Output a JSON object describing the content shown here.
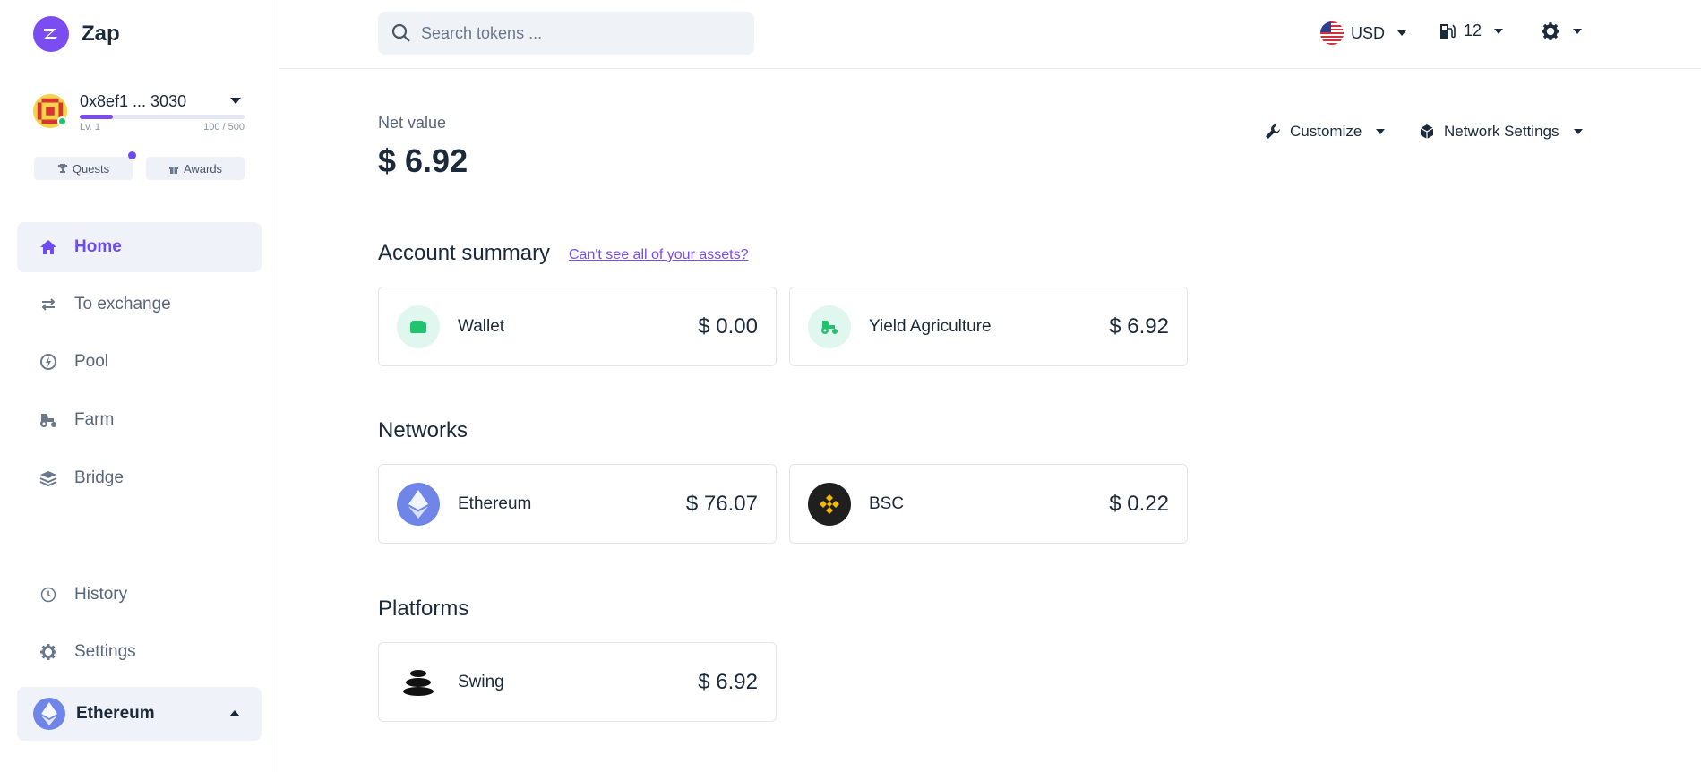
{
  "brand": {
    "name": "Zap"
  },
  "account": {
    "address": "0x8ef1 ... 3030",
    "level": "Lv. 1",
    "xp": "100 / 500",
    "xp_progress": 0.2
  },
  "chips": {
    "quests": "Quests",
    "awards": "Awards"
  },
  "nav": {
    "items": [
      {
        "label": "Home",
        "icon": "home-icon"
      },
      {
        "label": "To exchange",
        "icon": "swap-icon"
      },
      {
        "label": "Pool",
        "icon": "pool-icon"
      },
      {
        "label": "Farm",
        "icon": "tractor-icon"
      },
      {
        "label": "Bridge",
        "icon": "layers-icon"
      }
    ],
    "history": "History",
    "settings": "Settings",
    "network": "Ethereum"
  },
  "search": {
    "placeholder": "Search tokens ..."
  },
  "topbar": {
    "currency": "USD",
    "gas": "12"
  },
  "main": {
    "net_value_label": "Net value",
    "net_value": "$ 6.92",
    "customize": "Customize",
    "network_settings": "Network Settings",
    "account_summary_title": "Account summary",
    "assets_link": "Can't see all of your assets?",
    "summary_cards": [
      {
        "name": "Wallet",
        "value": "$ 0.00",
        "icon": "wallet-icon"
      },
      {
        "name": "Yield Agriculture",
        "value": "$ 6.92",
        "icon": "tractor-icon"
      }
    ],
    "networks_title": "Networks",
    "network_cards": [
      {
        "name": "Ethereum",
        "value": "$ 76.07",
        "icon": "ethereum-icon"
      },
      {
        "name": "BSC",
        "value": "$ 0.22",
        "icon": "bnb-icon"
      }
    ],
    "platforms_title": "Platforms",
    "platform_cards": [
      {
        "name": "Swing",
        "value": "$ 6.92",
        "icon": "swing-icon"
      }
    ]
  },
  "colors": {
    "accent": "#7b4cf0",
    "green": "#21c36f",
    "text": "#1b2a3a"
  }
}
